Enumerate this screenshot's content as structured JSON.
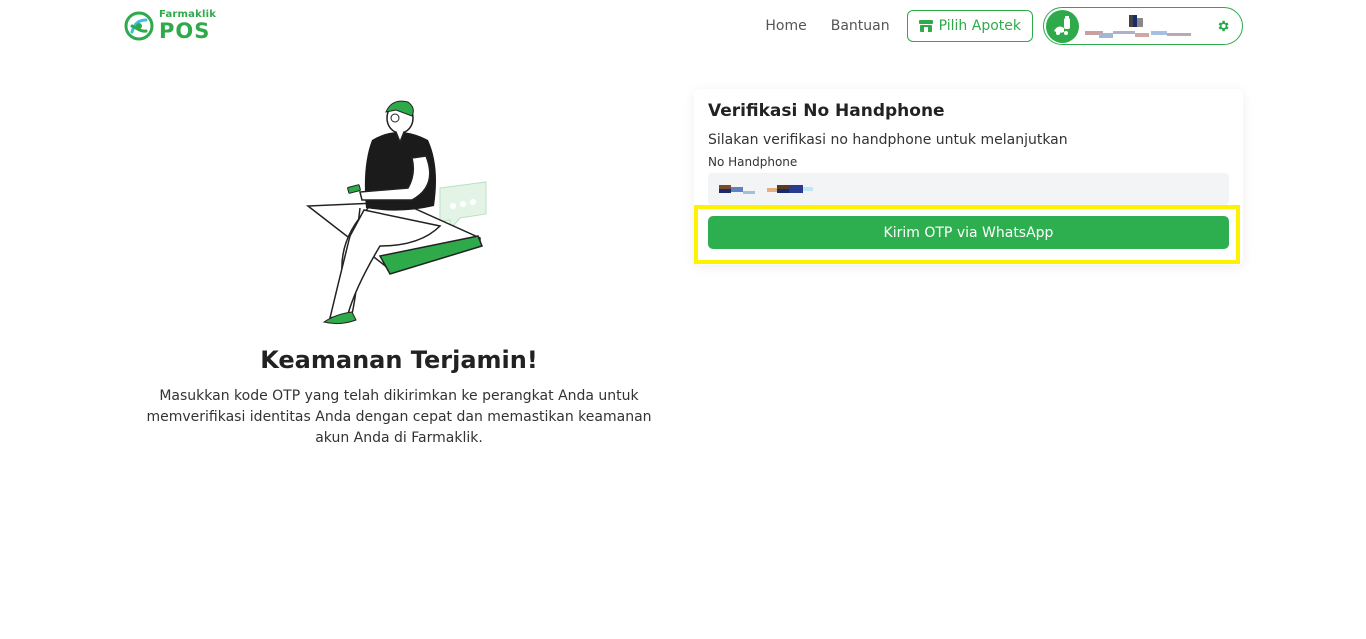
{
  "brand": {
    "small": "Farmaklik",
    "big": "POS"
  },
  "nav": {
    "home": "Home",
    "help": "Bantuan",
    "pharmacy_button": "Pilih Apotek"
  },
  "hero": {
    "title": "Keamanan Terjamin!",
    "description": "Masukkan kode OTP yang telah dikirimkan ke perangkat Anda untuk memverifikasi identitas Anda dengan cepat dan memastikan keamanan akun Anda di Farmaklik."
  },
  "verify": {
    "title": "Verifikasi No Handphone",
    "subtitle": "Silakan verifikasi no handphone untuk melanjutkan",
    "label": "No Handphone",
    "button": "Kirim OTP via WhatsApp"
  },
  "colors": {
    "accent": "#2eaa4b",
    "highlight": "#fff200"
  }
}
